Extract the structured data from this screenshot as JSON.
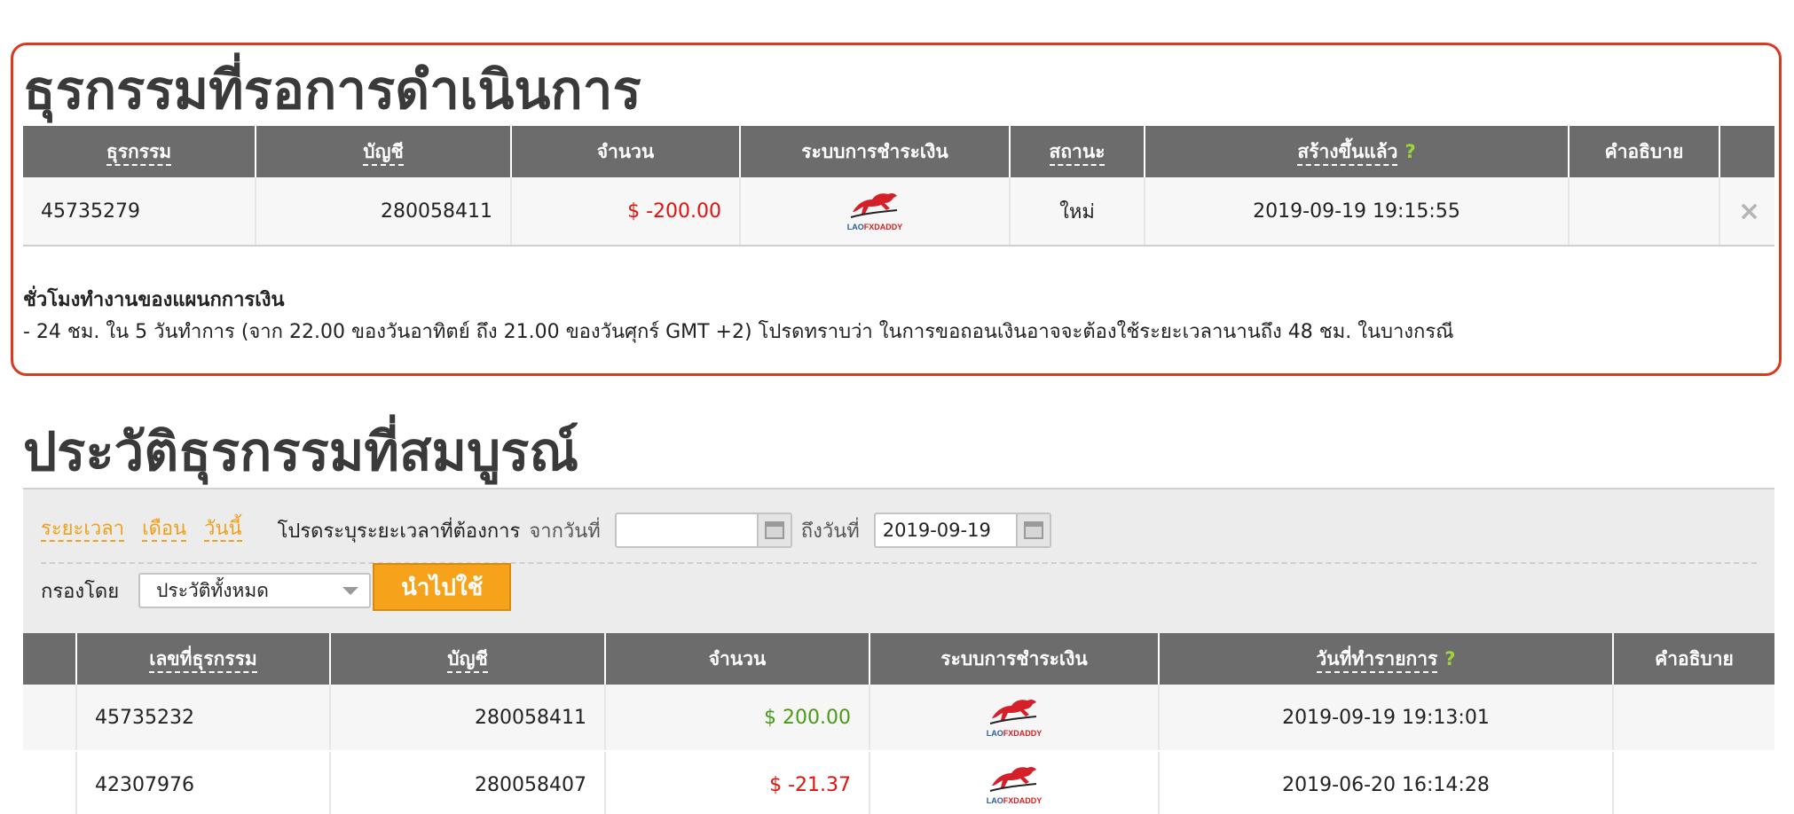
{
  "pending": {
    "title": "ธุรกรรมที่รอการดำเนินการ",
    "columns": {
      "transaction": "ธุรกรรม",
      "account": "บัญชี",
      "amount": "จำนวน",
      "payment_system": "ระบบการชำระเงิน",
      "status": "สถานะ",
      "created": "สร้างขึ้นแล้ว",
      "created_help": "?",
      "description": "คำอธิบาย"
    },
    "rows": [
      {
        "transaction": "45735279",
        "account": "280058411",
        "amount": "$ -200.00",
        "payment_logo_icon": "laofxdaddy-bull-logo",
        "status": "ใหม่",
        "created": "2019-09-19 19:15:55",
        "description": "",
        "cancel_icon": "×"
      }
    ],
    "working_hours": {
      "title": "ชั่วโมงทำงานของแผนกการเงิน",
      "text": "- 24 ชม. ใน 5 วันทำการ (จาก 22.00 ของวันอาทิตย์ ถึง 21.00 ของวันศุกร์ GMT +2) โปรดทราบว่า ในการขอถอนเงินอาจจะต้องใช้ระยะเวลานานถึง 48 ชม. ในบางกรณี"
    }
  },
  "history": {
    "title": "ประวัติธุรกรรมที่สมบูรณ์",
    "filter": {
      "period_links": [
        "ระยะเวลา",
        "เดือน",
        "วันนี้"
      ],
      "specify_label": "โปรดระบุระยะเวลาที่ต้องการ",
      "from_label": "จากวันที่",
      "from_value": "",
      "to_label": "ถึงวันที่",
      "to_value": "2019-09-19",
      "filter_by_label": "กรองโดย",
      "filter_selected": "ประวัติทั้งหมด",
      "apply_label": "นำไปใช้"
    },
    "columns": {
      "transaction_no": "เลขที่ธุรกรรม",
      "account": "บัญชี",
      "amount": "จำนวน",
      "payment_system": "ระบบการชำระเงิน",
      "transaction_date": "วันที่ทำรายการ",
      "transaction_date_help": "?",
      "description": "คำอธิบาย"
    },
    "rows": [
      {
        "transaction_no": "45735232",
        "account": "280058411",
        "amount": "$ 200.00",
        "payment_logo_icon": "laofxdaddy-bull-logo",
        "date": "2019-09-19 19:13:01",
        "description": ""
      },
      {
        "transaction_no": "42307976",
        "account": "280058407",
        "amount": "$ -21.37",
        "payment_logo_icon": "laofxdaddy-bull-logo",
        "date": "2019-06-20 16:14:28",
        "description": ""
      }
    ]
  },
  "logo": {
    "text_lao": "LAO",
    "text_fx": "FX",
    "text_daddy": "DADDY"
  },
  "colors": {
    "accent_orange": "#f7a21b",
    "header_gray": "#6c6c6c",
    "negative_red": "#e3120b",
    "positive_green": "#4a9a1a",
    "pending_border": "#d8391f"
  }
}
